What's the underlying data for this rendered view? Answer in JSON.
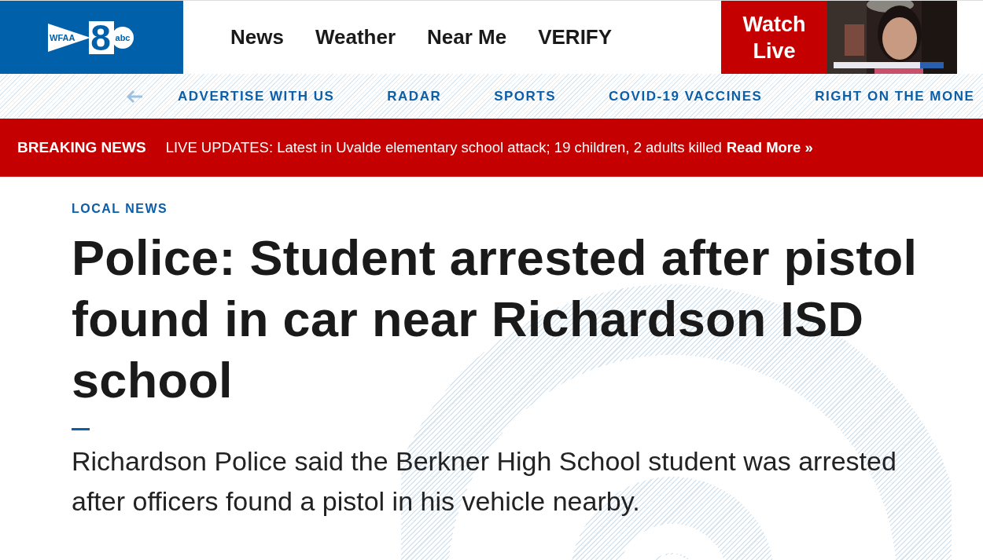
{
  "logo": {
    "station": "WFAA",
    "channel": "8",
    "network": "abc"
  },
  "main_nav": [
    {
      "label": "News"
    },
    {
      "label": "Weather"
    },
    {
      "label": "Near Me"
    },
    {
      "label": "VERIFY"
    }
  ],
  "watch_live": {
    "label": "Watch Live"
  },
  "sub_nav": [
    {
      "label": "ADVERTISE WITH US"
    },
    {
      "label": "RADAR"
    },
    {
      "label": "SPORTS"
    },
    {
      "label": "COVID-19 VACCINES"
    },
    {
      "label": "RIGHT ON THE MONE"
    }
  ],
  "breaking": {
    "tag": "BREAKING NEWS",
    "text": "LIVE UPDATES: Latest in Uvalde elementary school attack; 19 children, 2 adults killed",
    "link": "Read More »"
  },
  "article": {
    "category": "LOCAL NEWS",
    "headline": "Police: Student arrested after pistol found in car near Richardson ISD school",
    "summary": "Richardson Police said the Berkner High School student was arrested after officers found a pistol in his vehicle nearby."
  }
}
